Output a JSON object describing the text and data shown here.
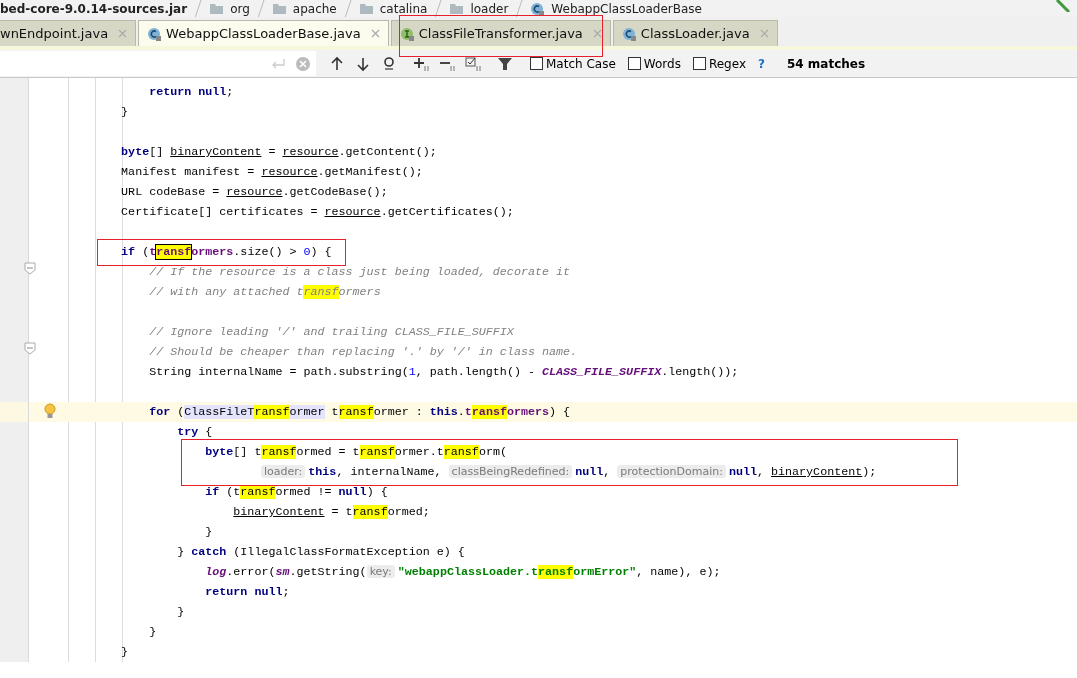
{
  "breadcrumbs": [
    {
      "label": "bed-core-9.0.14-sources.jar",
      "kind": "jar"
    },
    {
      "label": "org",
      "kind": "folder"
    },
    {
      "label": "apache",
      "kind": "folder"
    },
    {
      "label": "catalina",
      "kind": "folder"
    },
    {
      "label": "loader",
      "kind": "folder"
    },
    {
      "label": "WebappClassLoaderBase",
      "kind": "class"
    }
  ],
  "tabs": [
    {
      "label": "wnEndpoint.java",
      "selected": false,
      "boxed": false
    },
    {
      "label": "WebappClassLoaderBase.java",
      "kind": "class",
      "selected": true,
      "boxed": false
    },
    {
      "label": "ClassFileTransformer.java",
      "kind": "interface",
      "selected": false,
      "boxed": true
    },
    {
      "label": "ClassLoader.java",
      "kind": "class",
      "selected": false,
      "boxed": false
    }
  ],
  "find": {
    "options": [
      {
        "label": "Match Case",
        "checked": false
      },
      {
        "label": "Words",
        "checked": false
      },
      {
        "label": "Regex",
        "checked": false
      }
    ],
    "help": "?",
    "matches": "54 matches"
  },
  "code": [
    {
      "boxed": false,
      "caret": false,
      "tokens": [
        {
          "text": "            return null",
          "kind": "kw"
        },
        {
          "text": ";",
          "kind": "plain"
        }
      ]
    },
    {
      "boxed": false,
      "caret": false,
      "tokens": [
        {
          "text": "        }",
          "kind": "plain"
        }
      ]
    },
    {
      "boxed": false,
      "caret": false
    },
    {
      "boxed": false,
      "caret": false,
      "tokens": [
        {
          "text": "        byte",
          "kind": "kw"
        },
        {
          "text": "[] ",
          "kind": "plain"
        },
        {
          "text": "binaryContent",
          "kind": "ref"
        },
        {
          "text": " = ",
          "kind": "plain"
        },
        {
          "text": "resource",
          "kind": "ref"
        },
        {
          "text": ".getContent();",
          "kind": "plain"
        }
      ]
    },
    {
      "boxed": false,
      "caret": false,
      "tokens": [
        {
          "text": "        Manifest manifest = ",
          "kind": "plain"
        },
        {
          "text": "resource",
          "kind": "ref"
        },
        {
          "text": ".getManifest();",
          "kind": "plain"
        }
      ]
    },
    {
      "boxed": false,
      "caret": false,
      "tokens": [
        {
          "text": "        URL codeBase = ",
          "kind": "plain"
        },
        {
          "text": "resource",
          "kind": "ref"
        },
        {
          "text": ".getCodeBase();",
          "kind": "plain"
        }
      ]
    },
    {
      "boxed": false,
      "caret": false,
      "tokens": [
        {
          "text": "        Certificate[] certificates = ",
          "kind": "plain"
        },
        {
          "text": "resource",
          "kind": "ref"
        },
        {
          "text": ".getCertificates();",
          "kind": "plain"
        }
      ]
    },
    {
      "boxed": false,
      "caret": false
    },
    {
      "boxed": true,
      "caret": false,
      "tokens": [
        {
          "text": "        if",
          "kind": "kw"
        },
        {
          "text": " (",
          "kind": "plain"
        },
        {
          "text": "t",
          "kind": "field"
        },
        {
          "text": "ransf",
          "kind": "field",
          "match": true,
          "current": true
        },
        {
          "text": "ormers",
          "kind": "field"
        },
        {
          "text": ".size() > ",
          "kind": "plain"
        },
        {
          "text": "0",
          "kind": "num"
        },
        {
          "text": ") {",
          "kind": "plain"
        }
      ]
    },
    {
      "boxed": false,
      "caret": false,
      "fold_marker": true,
      "tokens": [
        {
          "text": "            // If the resource is a class just being loaded, decorate it",
          "kind": "comment"
        }
      ]
    },
    {
      "boxed": false,
      "caret": false,
      "tokens": [
        {
          "text": "            // with any attached t",
          "kind": "comment"
        },
        {
          "text": "ransf",
          "kind": "comment",
          "match": true
        },
        {
          "text": "ormers",
          "kind": "comment"
        }
      ]
    },
    {
      "boxed": false,
      "caret": false
    },
    {
      "boxed": false,
      "caret": false,
      "tokens": [
        {
          "text": "            // Ignore leading '/' and trailing CLASS_FILE_SUFFIX",
          "kind": "comment"
        }
      ]
    },
    {
      "boxed": false,
      "caret": false,
      "fold_marker": true,
      "tokens": [
        {
          "text": "            // Should be cheaper than replacing '.' by '/' in class name.",
          "kind": "comment"
        }
      ]
    },
    {
      "boxed": false,
      "caret": false,
      "tokens": [
        {
          "text": "            String internalName = path.substring(",
          "kind": "plain"
        },
        {
          "text": "1",
          "kind": "num"
        },
        {
          "text": ", path.length() - ",
          "kind": "plain"
        },
        {
          "text": "CLASS_FILE_SUFFIX",
          "kind": "static"
        },
        {
          "text": ".length());",
          "kind": "plain"
        }
      ]
    },
    {
      "boxed": false,
      "caret": false
    },
    {
      "boxed": false,
      "caret": true,
      "bulb": true,
      "tokens": [
        {
          "text": "            for",
          "kind": "kw"
        },
        {
          "text": " (",
          "kind": "plain"
        },
        {
          "text": "ClassFileT",
          "kind": "usage"
        },
        {
          "text": "ransf",
          "kind": "usage",
          "match": true
        },
        {
          "text": "ormer",
          "kind": "usage"
        },
        {
          "text": " t",
          "kind": "plain"
        },
        {
          "text": "ransf",
          "kind": "plain",
          "match": true
        },
        {
          "text": "ormer : ",
          "kind": "plain"
        },
        {
          "text": "this",
          "kind": "kw"
        },
        {
          "text": ".",
          "kind": "plain"
        },
        {
          "text": "t",
          "kind": "field"
        },
        {
          "text": "ransf",
          "kind": "field",
          "match": true
        },
        {
          "text": "ormers",
          "kind": "field"
        },
        {
          "text": ") {",
          "kind": "plain"
        }
      ]
    },
    {
      "boxed": false,
      "caret": false,
      "tokens": [
        {
          "text": "                try",
          "kind": "kw"
        },
        {
          "text": " {",
          "kind": "plain"
        }
      ]
    },
    {
      "boxed": true,
      "caret": false,
      "tokens": [
        {
          "text": "                    byte",
          "kind": "kw"
        },
        {
          "text": "[] t",
          "kind": "plain"
        },
        {
          "text": "ransf",
          "kind": "plain",
          "match": true
        },
        {
          "text": "ormed = t",
          "kind": "plain"
        },
        {
          "text": "ransf",
          "kind": "plain",
          "match": true
        },
        {
          "text": "ormer.t",
          "kind": "plain"
        },
        {
          "text": "ransf",
          "kind": "plain",
          "match": true
        },
        {
          "text": "orm(",
          "kind": "plain"
        }
      ]
    },
    {
      "boxed": true,
      "caret": false,
      "tokens": [
        {
          "text": "loader:",
          "kind": "hint"
        },
        {
          "text": "this",
          "kind": "kw"
        },
        {
          "text": ", internalName, ",
          "kind": "plain"
        },
        {
          "text": "classBeingRedefined:",
          "kind": "hint"
        },
        {
          "text": "null",
          "kind": "kw"
        },
        {
          "text": ", ",
          "kind": "plain"
        },
        {
          "text": "protectionDomain:",
          "kind": "hint"
        },
        {
          "text": "null",
          "kind": "kw"
        },
        {
          "text": ", ",
          "kind": "plain"
        },
        {
          "text": "binaryContent",
          "kind": "ref"
        },
        {
          "text": ");",
          "kind": "plain"
        }
      ]
    },
    {
      "boxed": false,
      "caret": false,
      "tokens": [
        {
          "text": "                    if",
          "kind": "kw"
        },
        {
          "text": " (t",
          "kind": "plain"
        },
        {
          "text": "ransf",
          "kind": "plain",
          "match": true
        },
        {
          "text": "ormed != ",
          "kind": "plain"
        },
        {
          "text": "null",
          "kind": "kw"
        },
        {
          "text": ") {",
          "kind": "plain"
        }
      ]
    },
    {
      "boxed": false,
      "caret": false,
      "tokens": [
        {
          "text": "                        binaryContent",
          "kind": "ref"
        },
        {
          "text": " = t",
          "kind": "plain"
        },
        {
          "text": "ransf",
          "kind": "plain",
          "match": true
        },
        {
          "text": "ormed;",
          "kind": "plain"
        }
      ]
    },
    {
      "boxed": false,
      "caret": false,
      "tokens": [
        {
          "text": "                    }",
          "kind": "plain"
        }
      ]
    },
    {
      "boxed": false,
      "caret": false,
      "tokens": [
        {
          "text": "                } ",
          "kind": "plain"
        },
        {
          "text": "catch",
          "kind": "kw"
        },
        {
          "text": " (IllegalClassFormatException e) {",
          "kind": "plain"
        }
      ]
    },
    {
      "boxed": false,
      "caret": false,
      "tokens": [
        {
          "text": "                    log",
          "kind": "static"
        },
        {
          "text": ".error(",
          "kind": "plain"
        },
        {
          "text": "sm",
          "kind": "static"
        },
        {
          "text": ".getString(",
          "kind": "plain"
        },
        {
          "text": "key:",
          "kind": "hint"
        },
        {
          "text": "\"webappClassLoader.t",
          "kind": "string"
        },
        {
          "text": "ransf",
          "kind": "string",
          "match": true
        },
        {
          "text": "ormError\"",
          "kind": "string"
        },
        {
          "text": ", name), e);",
          "kind": "plain"
        }
      ]
    },
    {
      "boxed": false,
      "caret": false,
      "tokens": [
        {
          "text": "                    return null",
          "kind": "kw"
        },
        {
          "text": ";",
          "kind": "plain"
        }
      ]
    },
    {
      "boxed": false,
      "caret": false,
      "tokens": [
        {
          "text": "                }",
          "kind": "plain"
        }
      ]
    },
    {
      "boxed": false,
      "caret": false,
      "tokens": [
        {
          "text": "            }",
          "kind": "plain"
        }
      ]
    },
    {
      "boxed": false,
      "caret": false,
      "tokens": [
        {
          "text": "        }",
          "kind": "plain"
        }
      ]
    }
  ]
}
